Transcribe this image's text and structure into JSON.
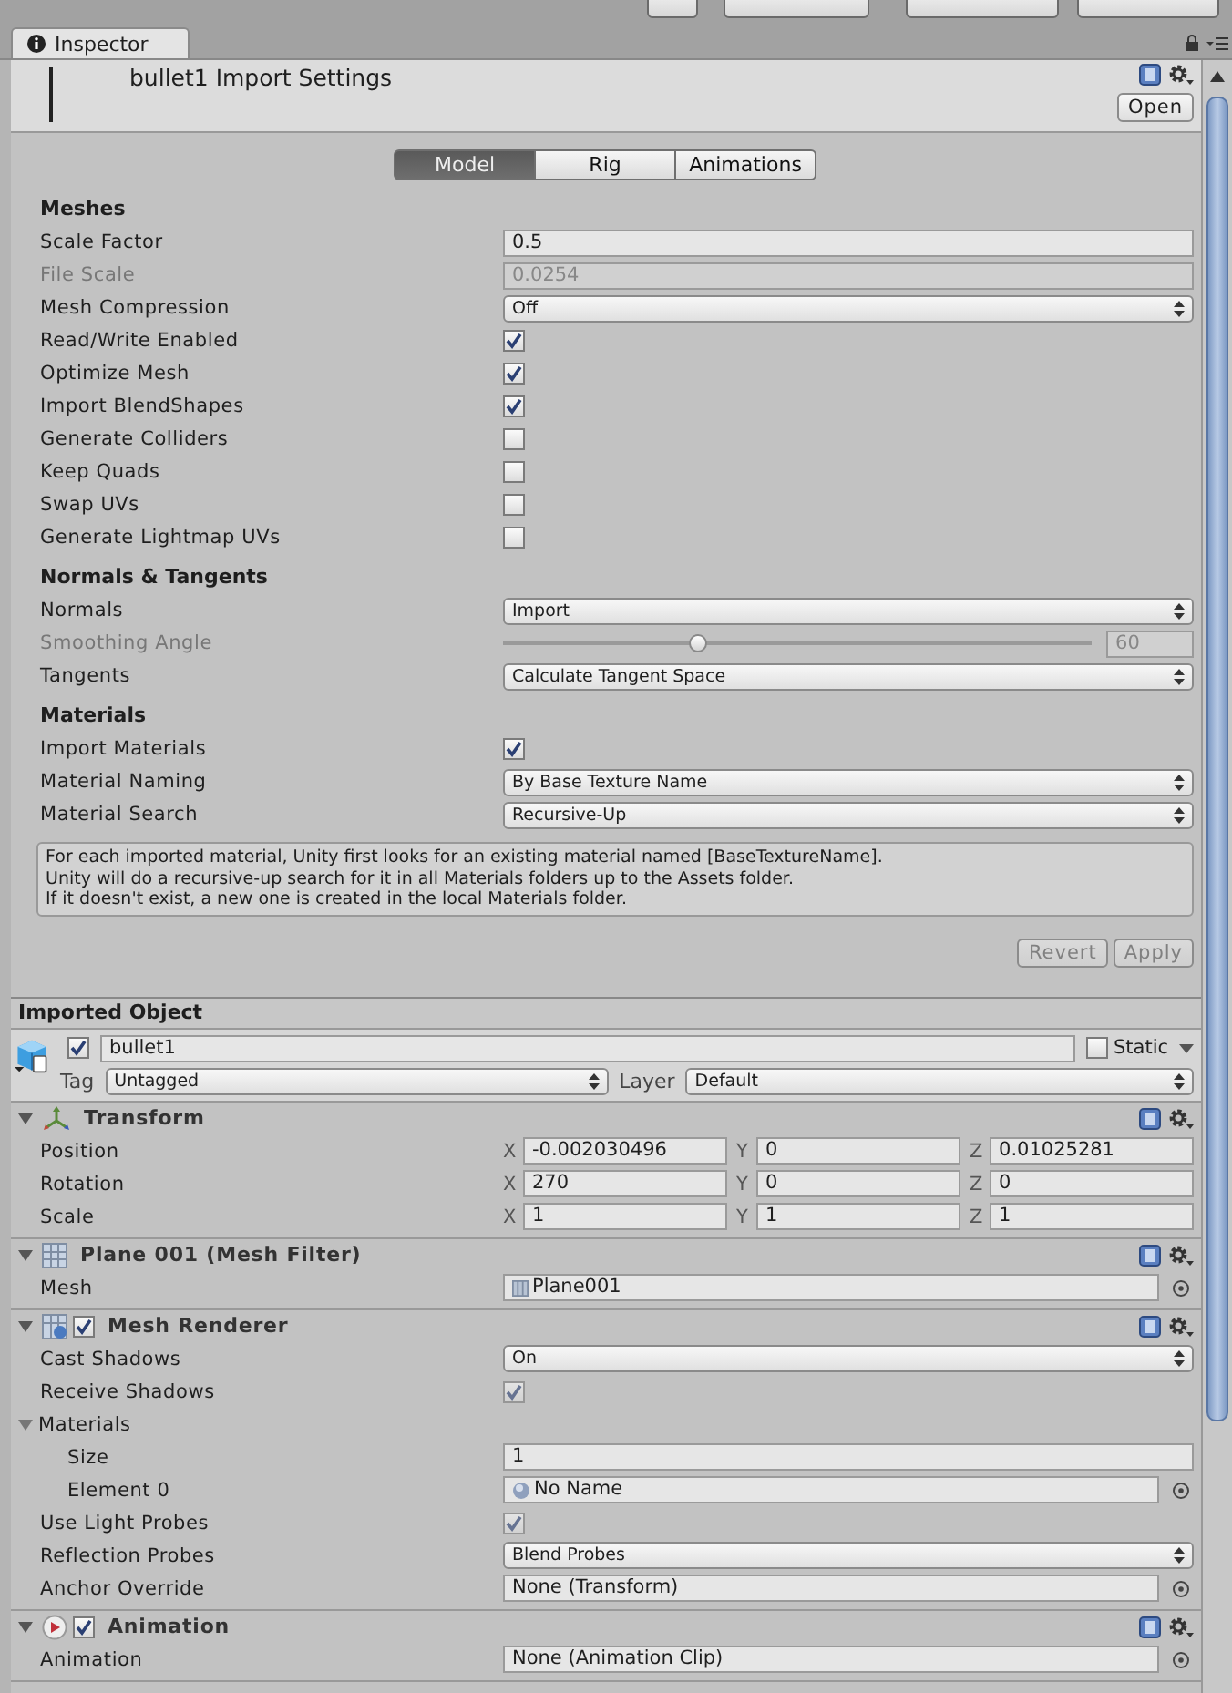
{
  "panel_tab": {
    "label": "Inspector",
    "selected": true
  },
  "asset_header": {
    "title": "bullet1 Import Settings",
    "open_button": "Open"
  },
  "mode_tabs": [
    {
      "label": "Model",
      "selected": true
    },
    {
      "label": "Rig",
      "selected": false
    },
    {
      "label": "Animations",
      "selected": false
    }
  ],
  "import_rows": [
    {
      "kind": "section",
      "label": "Meshes"
    },
    {
      "kind": "text",
      "label": "Scale Factor",
      "value": "0.5",
      "disabled": false
    },
    {
      "kind": "text",
      "label": "File Scale",
      "value": "0.0254",
      "disabled": true
    },
    {
      "kind": "dropdown",
      "label": "Mesh Compression",
      "value": "Off",
      "disabled": false
    },
    {
      "kind": "checkbox",
      "label": "Read/Write Enabled",
      "checked": true,
      "disabled": false
    },
    {
      "kind": "checkbox",
      "label": "Optimize Mesh",
      "checked": true,
      "disabled": false
    },
    {
      "kind": "checkbox",
      "label": "Import BlendShapes",
      "checked": true,
      "disabled": false
    },
    {
      "kind": "checkbox",
      "label": "Generate Colliders",
      "checked": false,
      "disabled": false
    },
    {
      "kind": "checkbox",
      "label": "Keep Quads",
      "checked": false,
      "disabled": false
    },
    {
      "kind": "checkbox",
      "label": "Swap UVs",
      "checked": false,
      "disabled": false
    },
    {
      "kind": "checkbox",
      "label": "Generate Lightmap UVs",
      "checked": false,
      "disabled": false
    },
    {
      "kind": "section",
      "label": "Normals & Tangents"
    },
    {
      "kind": "dropdown",
      "label": "Normals",
      "value": "Import",
      "disabled": false
    },
    {
      "kind": "slider",
      "label": "Smoothing Angle",
      "level": 0.33,
      "value": "60",
      "disabled": true
    },
    {
      "kind": "dropdown",
      "label": "Tangents",
      "value": "Calculate Tangent Space",
      "disabled": false
    },
    {
      "kind": "section",
      "label": "Materials"
    },
    {
      "kind": "checkbox",
      "label": "Import Materials",
      "checked": true,
      "disabled": false
    },
    {
      "kind": "dropdown",
      "label": "Material Naming",
      "value": "By Base Texture Name",
      "disabled": false
    },
    {
      "kind": "dropdown",
      "label": "Material Search",
      "value": "Recursive-Up",
      "disabled": false
    }
  ],
  "info_box": [
    "For each imported material, Unity first looks for an existing material named [BaseTextureName].",
    "Unity will do a recursive-up search for it in all Materials folders up to the Assets folder.",
    "If it doesn't exist, a new one is created in the local Materials folder."
  ],
  "action_buttons": [
    {
      "label": "Revert",
      "disabled": true
    },
    {
      "label": "Apply",
      "disabled": true
    }
  ],
  "imported_object": {
    "title": "Imported Object",
    "active": true,
    "name": "bullet1",
    "static_label": "Static",
    "static": false,
    "tag_label": "Tag",
    "tag": "Untagged",
    "layer_label": "Layer",
    "layer": "Default"
  },
  "components": [
    {
      "kind": "transform",
      "name": "Transform",
      "expanded": true,
      "rows": [
        {
          "kind": "vector3",
          "label": "Position",
          "axes": [
            {
              "axis": "X",
              "value": "-0.002030496"
            },
            {
              "axis": "Y",
              "value": "0"
            },
            {
              "axis": "Z",
              "value": "0.01025281"
            }
          ]
        },
        {
          "kind": "vector3",
          "label": "Rotation",
          "axes": [
            {
              "axis": "X",
              "value": "270"
            },
            {
              "axis": "Y",
              "value": "0"
            },
            {
              "axis": "Z",
              "value": "0"
            }
          ]
        },
        {
          "kind": "vector3",
          "label": "Scale",
          "axes": [
            {
              "axis": "X",
              "value": "1"
            },
            {
              "axis": "Y",
              "value": "1"
            },
            {
              "axis": "Z",
              "value": "1"
            }
          ]
        }
      ]
    },
    {
      "kind": "mesh_filter",
      "name": "Plane 001 (Mesh Filter)",
      "expanded": true,
      "rows": [
        {
          "kind": "object",
          "label": "Mesh",
          "value": "Plane001"
        }
      ]
    },
    {
      "kind": "mesh_renderer",
      "name": "Mesh Renderer",
      "enabled": true,
      "expanded": true,
      "rows": [
        {
          "kind": "dropdown",
          "label": "Cast Shadows",
          "value": "On"
        },
        {
          "kind": "checkbox",
          "label": "Receive Shadows",
          "checked": true
        },
        {
          "kind": "foldout",
          "label": "Materials",
          "expanded": true,
          "children": [
            {
              "kind": "text",
              "label": "Size",
              "value": "1"
            },
            {
              "kind": "object",
              "label": "Element 0",
              "value": "No Name"
            }
          ]
        },
        {
          "kind": "checkbox",
          "label": "Use Light Probes",
          "checked": true
        },
        {
          "kind": "dropdown",
          "label": "Reflection Probes",
          "value": "Blend Probes"
        },
        {
          "kind": "object",
          "label": "Anchor Override",
          "value": "None (Transform)"
        }
      ]
    },
    {
      "kind": "animation",
      "name": "Animation",
      "enabled": true,
      "expanded": true,
      "rows": [
        {
          "kind": "object",
          "label": "Animation",
          "value": "None (Animation Clip)"
        }
      ]
    }
  ]
}
